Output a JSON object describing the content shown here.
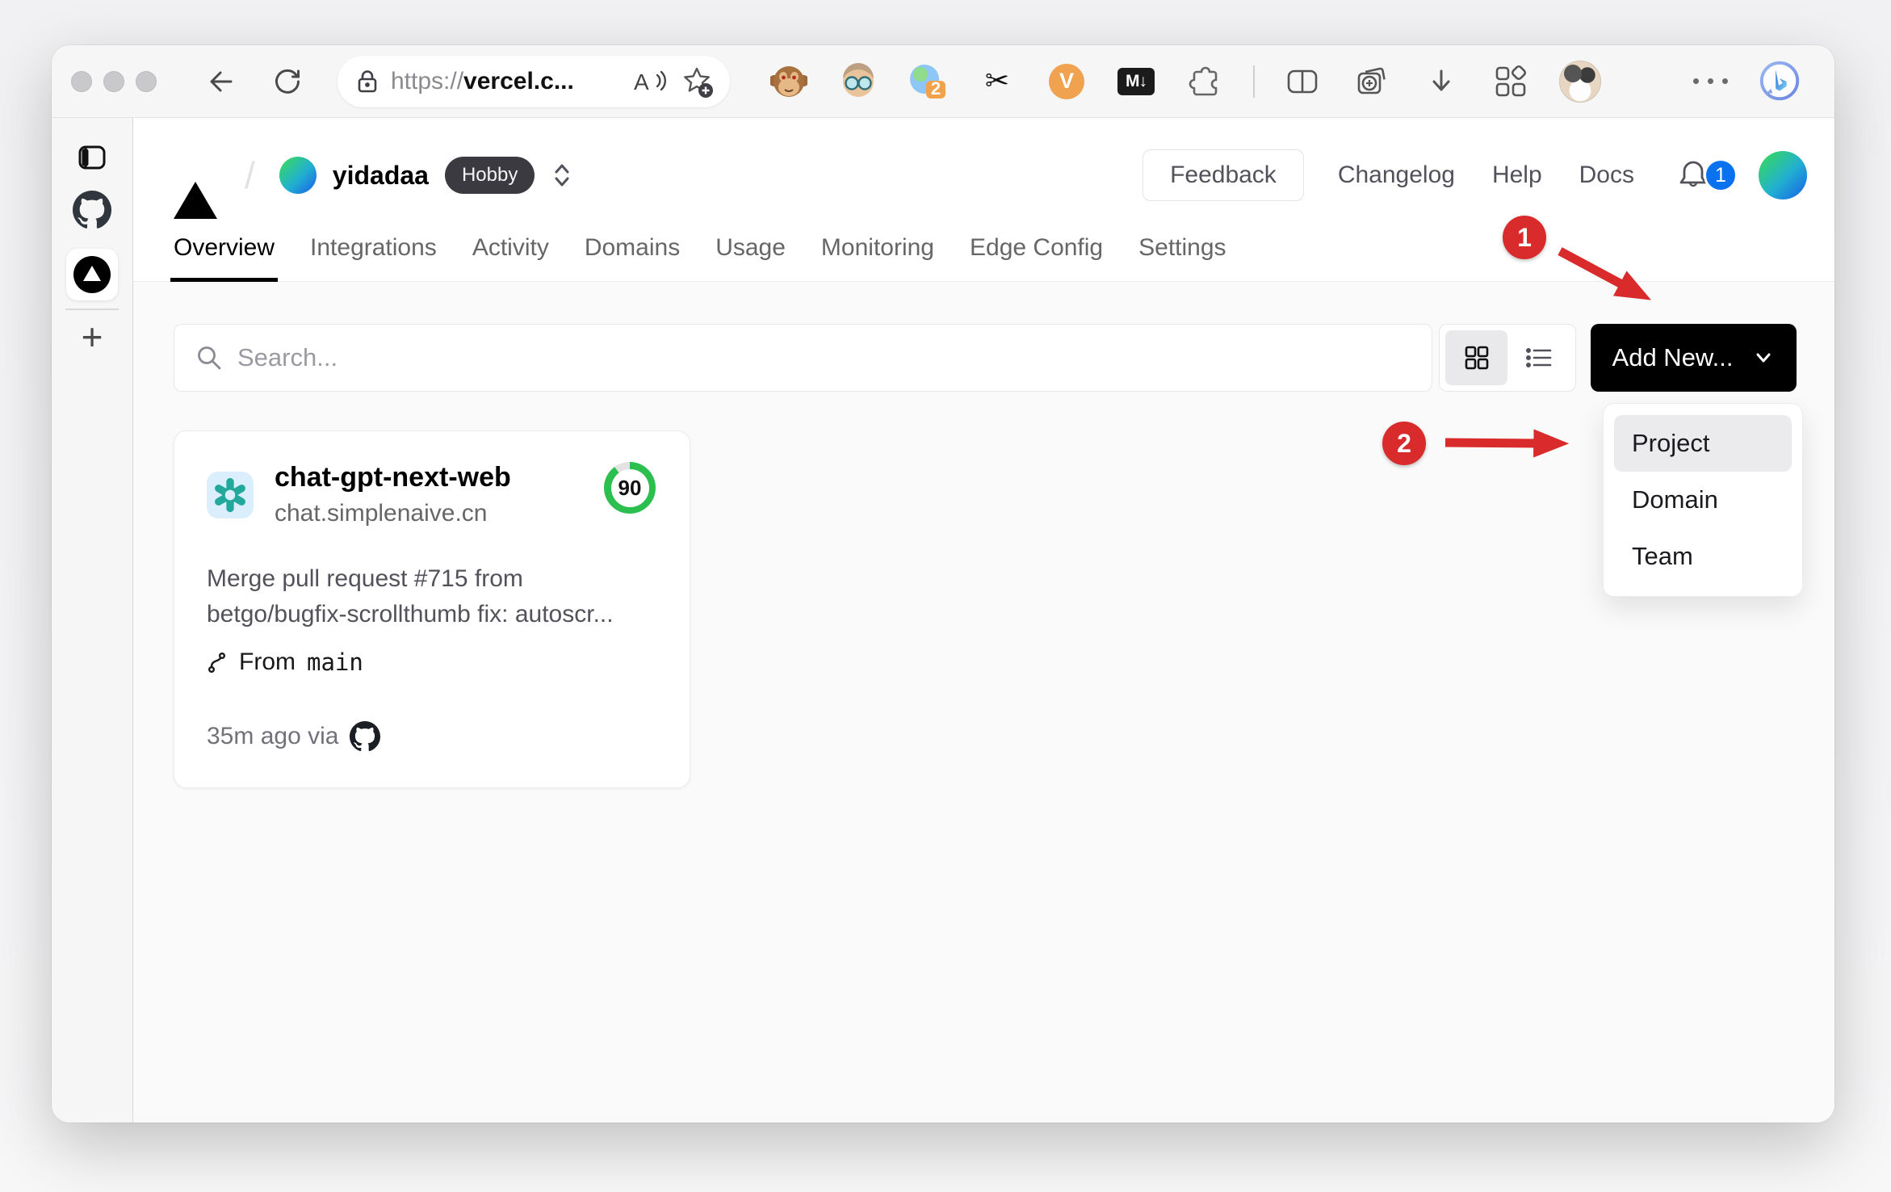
{
  "browser": {
    "url": {
      "scheme": "https://",
      "host": "vercel.c..."
    },
    "extension_badge": "2",
    "labels": {
      "vimium": "V",
      "markdown": "M↓"
    },
    "glyphs": {
      "scissors": "✂",
      "new_tab": "+",
      "slash": "/"
    }
  },
  "vercel": {
    "team_name": "yidadaa",
    "plan_badge": "Hobby",
    "nav_links": [
      "Feedback",
      "Changelog",
      "Help",
      "Docs"
    ],
    "notification_count": "1",
    "tabs": [
      "Overview",
      "Integrations",
      "Activity",
      "Domains",
      "Usage",
      "Monitoring",
      "Edge Config",
      "Settings"
    ],
    "search_placeholder": "Search...",
    "add_new_label": "Add New...",
    "dropdown_items": [
      "Project",
      "Domain",
      "Team"
    ],
    "card": {
      "name": "chat-gpt-next-web",
      "domain": "chat.simplenaive.cn",
      "score": "90",
      "commit_line1": "Merge pull request #715 from",
      "commit_line2": "betgo/bugfix-scrollthumb fix: autoscr...",
      "from_label": "From",
      "branch": "main",
      "time_label": "35m ago via"
    }
  },
  "annotations": {
    "step1": "1",
    "step2": "2"
  },
  "colors": {
    "annotation_red": "#d92b2b",
    "score_green": "#2dbe50",
    "notification_blue": "#0a72ef",
    "openai_teal": "#16a394",
    "vercel_black": "#000000"
  }
}
